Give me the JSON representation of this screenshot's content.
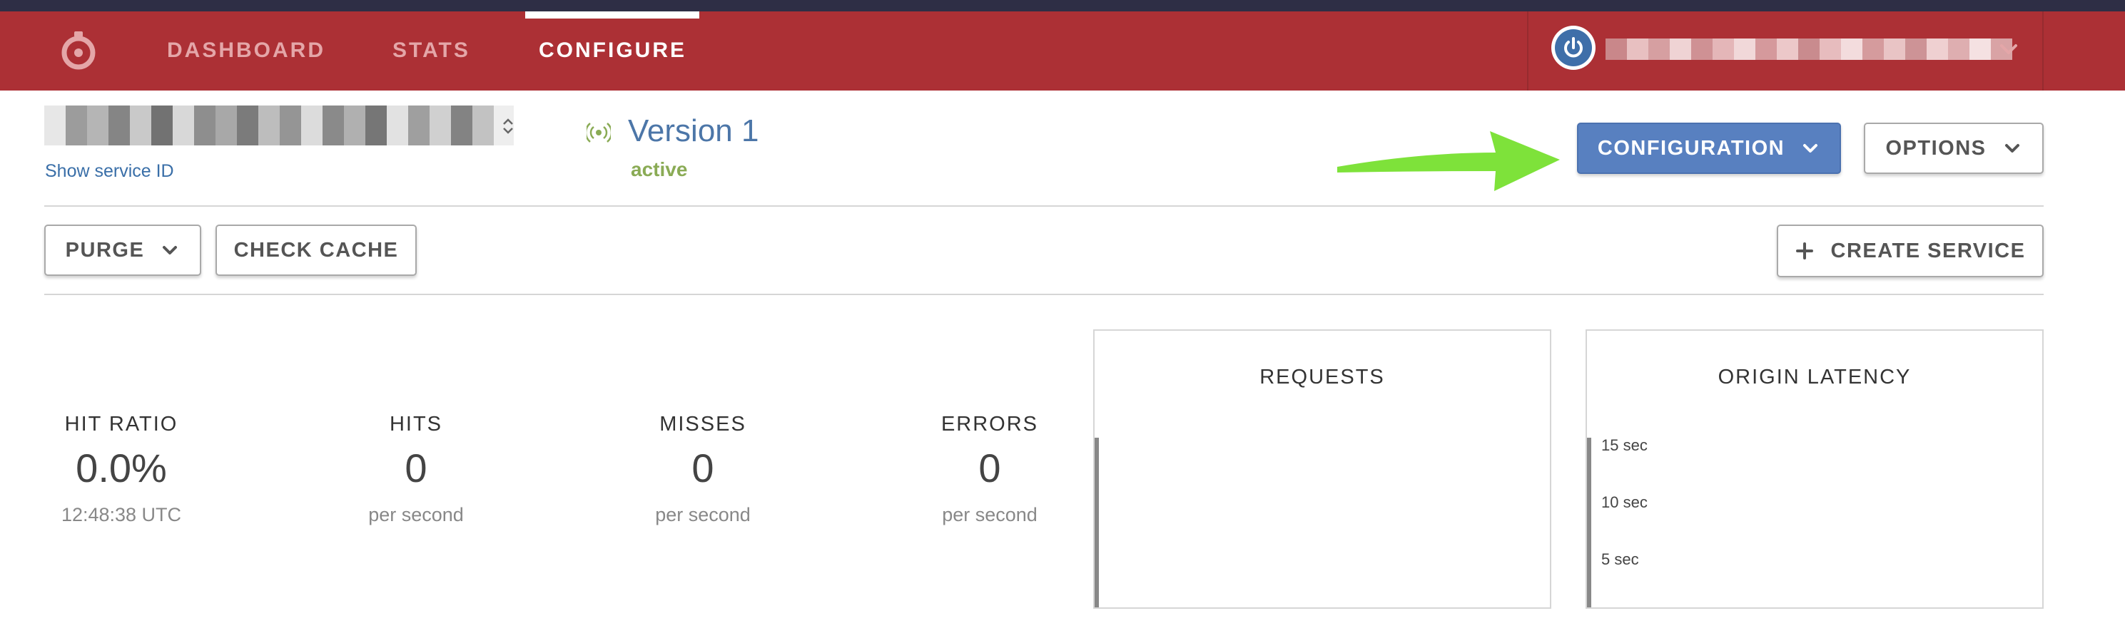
{
  "nav": {
    "items": [
      {
        "label": "DASHBOARD",
        "active": false
      },
      {
        "label": "STATS",
        "active": false
      },
      {
        "label": "CONFIGURE",
        "active": true
      }
    ],
    "user_menu_name_redacted": true
  },
  "service": {
    "name_redacted": true,
    "show_id_link": "Show service ID"
  },
  "version": {
    "title": "Version 1",
    "status": "active"
  },
  "buttons": {
    "configuration": "CONFIGURATION",
    "options": "OPTIONS",
    "purge": "PURGE",
    "check_cache": "CHECK CACHE",
    "create_service": "CREATE SERVICE"
  },
  "stats": [
    {
      "label": "HIT RATIO",
      "value": "0.0%",
      "sub": "12:48:38 UTC"
    },
    {
      "label": "HITS",
      "value": "0",
      "sub": "per second"
    },
    {
      "label": "MISSES",
      "value": "0",
      "sub": "per second"
    },
    {
      "label": "ERRORS",
      "value": "0",
      "sub": "per second"
    }
  ],
  "charts": {
    "requests": {
      "title": "REQUESTS"
    },
    "origin_latency": {
      "title": "ORIGIN LATENCY",
      "y_ticks": [
        "15 sec",
        "10 sec",
        "5 sec"
      ]
    }
  },
  "colors": {
    "nav_bg": "#ac3035",
    "top_stripe": "#2e2e45",
    "primary_button": "#5880c0",
    "version_text": "#4c76a8",
    "status_active": "#8aab55",
    "annotation_arrow": "#7ee23a"
  },
  "icons": {
    "logo": "stopwatch-icon",
    "user": "power-icon",
    "version": "signal-icon",
    "sort": "updown-arrows-icon",
    "dropdown": "chevron-down-icon",
    "add": "plus-icon"
  }
}
